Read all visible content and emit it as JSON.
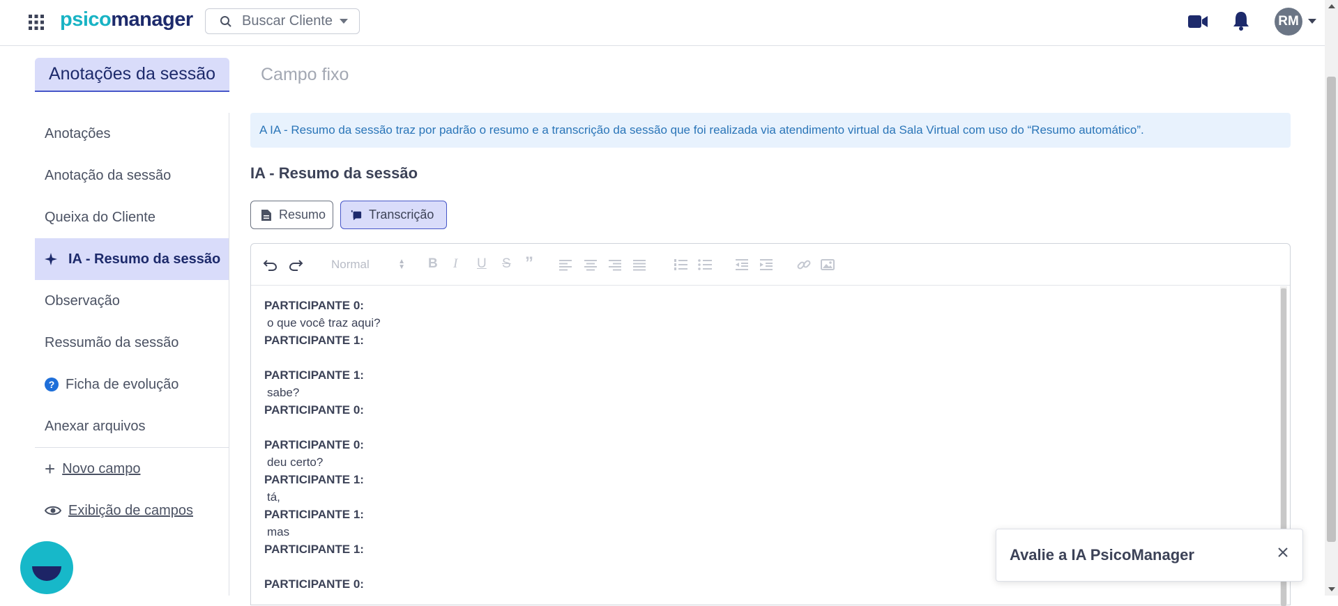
{
  "header": {
    "logo_part1": "psico",
    "logo_part2": "manager",
    "search_placeholder": "Buscar Cliente",
    "avatar_initials": "RM"
  },
  "tabs": [
    {
      "label": "Anotações da sessão",
      "active": true
    },
    {
      "label": "Campo fixo",
      "active": false
    }
  ],
  "sidebar": {
    "items": [
      {
        "label": "Anotações"
      },
      {
        "label": "Anotação da sessão"
      },
      {
        "label": "Queixa do Cliente"
      },
      {
        "label": "IA - Resumo da sessão",
        "active": true
      },
      {
        "label": "Observação"
      },
      {
        "label": "Ressumão da sessão"
      },
      {
        "label": "Ficha de evolução"
      },
      {
        "label": "Anexar arquivos"
      }
    ],
    "actions": {
      "new_field": "Novo campo",
      "field_display": "Exibição de campos"
    }
  },
  "main": {
    "banner": "A IA - Resumo da sessão traz por padrão o resumo e a transcrição da sessão que foi realizada via atendimento virtual da Sala Virtual com uso do “Resumo automático”.",
    "title": "IA - Resumo da sessão",
    "buttons": {
      "resumo": "Resumo",
      "transcricao": "Transcrição"
    },
    "editor": {
      "format_select": "Normal",
      "lines": [
        {
          "speaker": "PARTICIPANTE 0:",
          "text": "o que você traz aqui?"
        },
        {
          "speaker": "PARTICIPANTE 1:",
          "text": ""
        },
        {
          "speaker": "PARTICIPANTE 1:",
          "text": "sabe?"
        },
        {
          "speaker": "PARTICIPANTE 0:",
          "text": ""
        },
        {
          "speaker": "PARTICIPANTE 0:",
          "text": "deu certo?"
        },
        {
          "speaker": "PARTICIPANTE 1:",
          "text": "tá,"
        },
        {
          "speaker": "PARTICIPANTE 1:",
          "text": "mas"
        },
        {
          "speaker": "PARTICIPANTE 1:",
          "text": ""
        },
        {
          "speaker": "PARTICIPANTE 0:",
          "text": ""
        }
      ]
    }
  },
  "toast": {
    "title": "Avalie a IA PsicoManager"
  },
  "colors": {
    "accent": "#4656c8",
    "accent_light": "#d9dcfa",
    "brand_teal": "#18b3c4",
    "brand_navy": "#1d2a6b",
    "info_bg": "#e8f2fd",
    "info_text": "#2a75b8"
  }
}
